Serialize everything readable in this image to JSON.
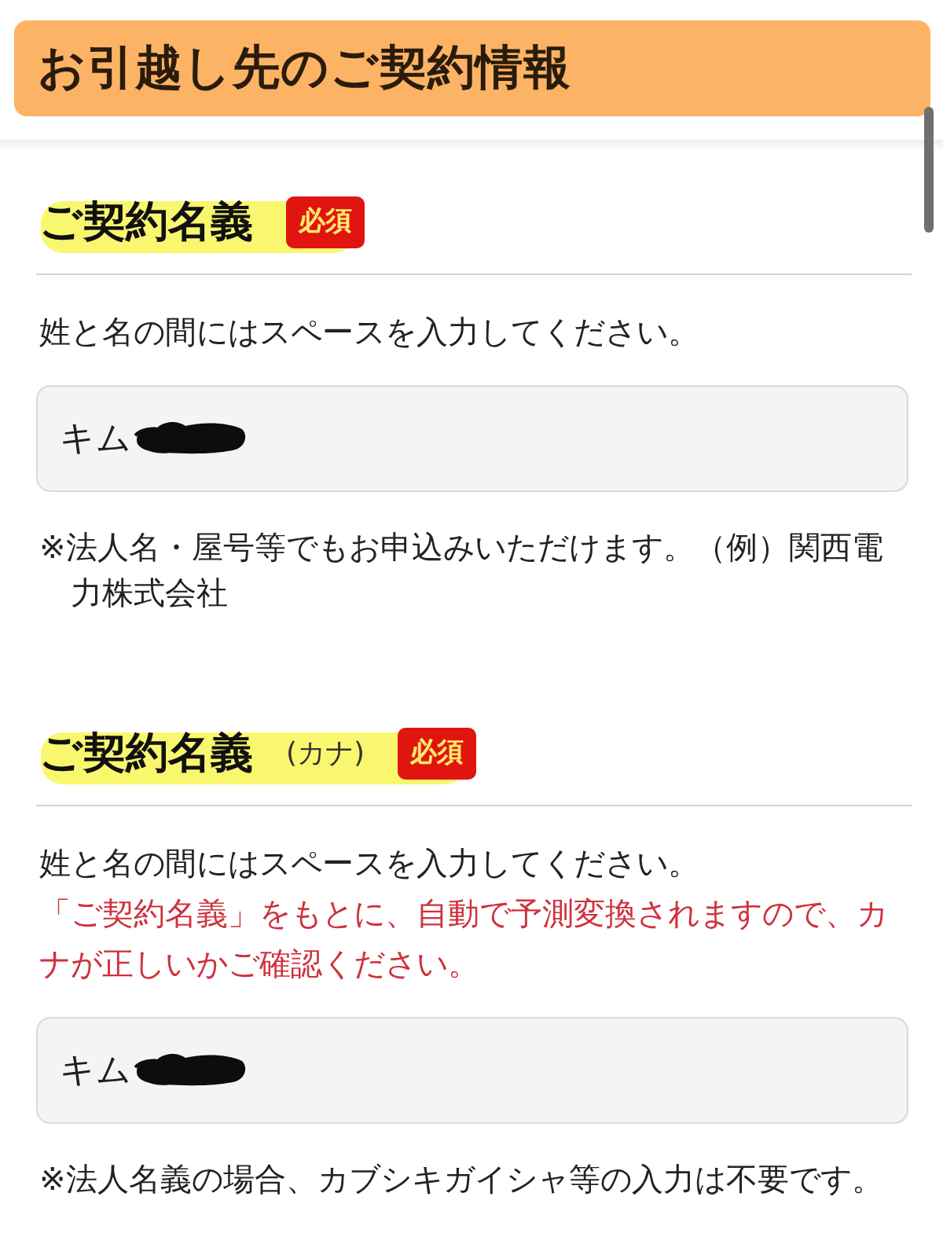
{
  "header": {
    "title": "お引越し先のご契約情報"
  },
  "sections": [
    {
      "heading": "ご契約名義",
      "highlighted": true,
      "badge": "必須",
      "instructions": [
        {
          "kind": "plain",
          "text": "姓と名の間にはスペースを入力してください。"
        }
      ],
      "field": {
        "value": "キム",
        "redacted": true
      },
      "note": "※法人名・屋号等でもお申込みいただけます。（例）関西電力株式会社"
    },
    {
      "heading": "ご契約名義",
      "subheading": "(カナ)",
      "highlighted": true,
      "badge": "必須",
      "instructions": [
        {
          "kind": "plain",
          "text": "姓と名の間にはスペースを入力してください。"
        },
        {
          "kind": "warning",
          "text": "「ご契約名義」をもとに、自動で予測変換されますので、カナが正しいかご確認ください。"
        }
      ],
      "field": {
        "value": "キム",
        "redacted": true
      },
      "note": "※法人名義の場合、カブシキガイシャ等の入力は不要です。"
    }
  ]
}
